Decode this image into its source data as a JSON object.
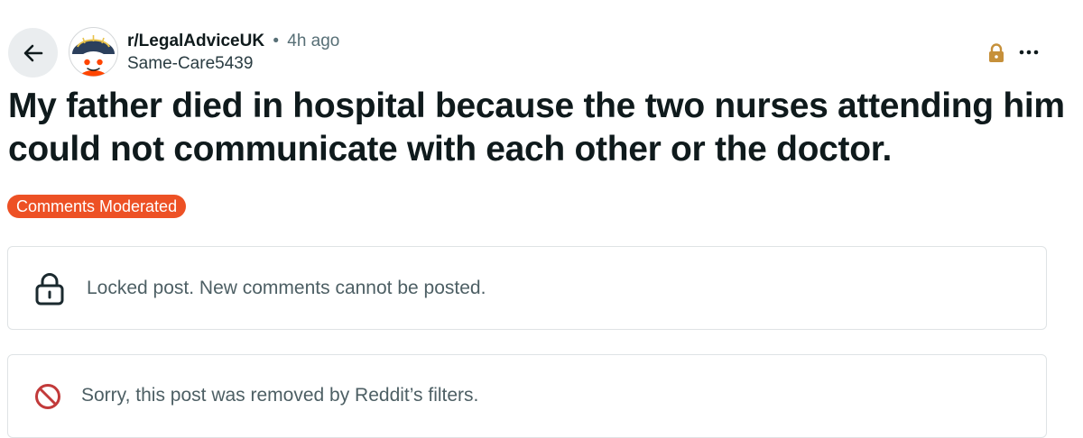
{
  "header": {
    "back_icon": "arrow-left-icon",
    "subreddit": "r/LegalAdviceUK",
    "separator": "•",
    "time_ago": "4h ago",
    "username": "Same-Care5439",
    "lock_icon": "lock-icon",
    "more_icon": "more-horizontal-icon",
    "more_label": "•••"
  },
  "post": {
    "title": "My father died in hospital because the two nurses attending him could not communicate with each other or the doctor.",
    "flair": "Comments Moderated"
  },
  "notices": {
    "locked": {
      "icon": "lock-icon",
      "text": "Locked post. New comments cannot be posted."
    },
    "removed": {
      "icon": "prohibited-icon",
      "text": "Sorry, this post was removed by Reddit’s filters."
    }
  },
  "colors": {
    "flair_bg": "#ed5125",
    "lock_badge": "#c6903a",
    "removed_icon": "#c23a3a",
    "back_button_bg": "#eaedef"
  }
}
